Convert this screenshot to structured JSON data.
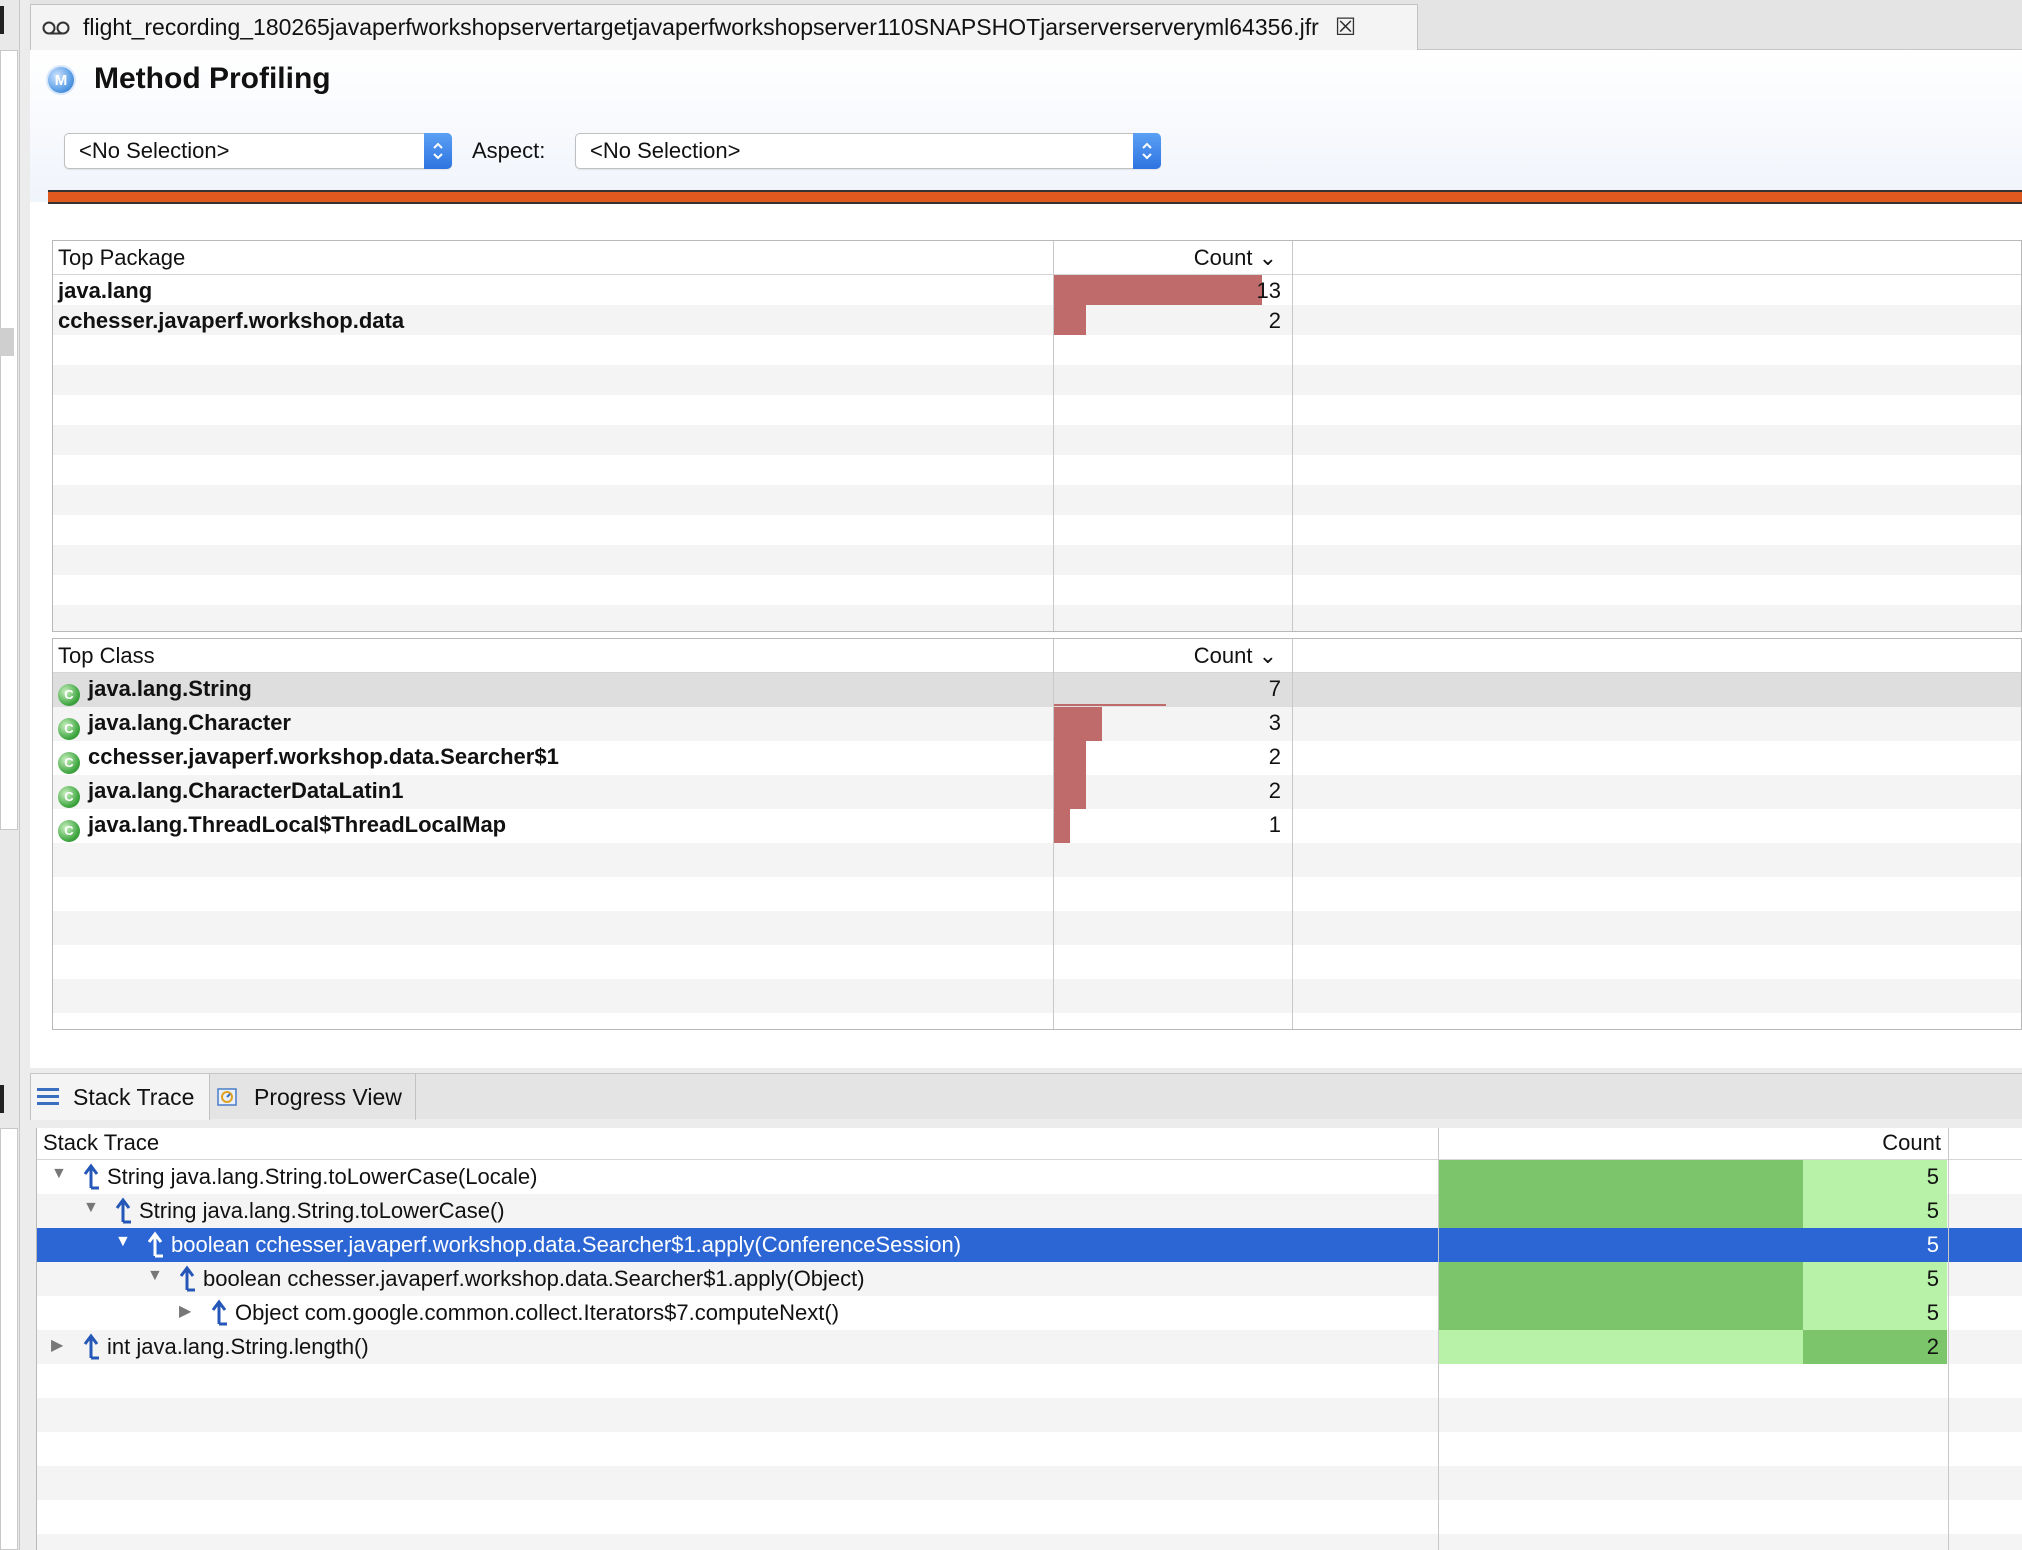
{
  "editor_tab": {
    "title": "flight_recording_180265javaperfworkshopservertargetjavaperfworkshopserver110SNAPSHOTjarserverserveryml64356.jfr",
    "icon": "recording-icon",
    "close_icon": "close-icon"
  },
  "header": {
    "icon_letter": "M",
    "title": "Method Profiling",
    "selection_combo": "<No Selection>",
    "aspect_label": "Aspect:",
    "aspect_combo": "<No Selection>",
    "accent_color": "#e05a20"
  },
  "top_package": {
    "header_name": "Top Package",
    "header_count": "Count",
    "rows": [
      {
        "name": "java.lang",
        "count": "13",
        "fraction": 1.0
      },
      {
        "name": "cchesser.javaperf.workshop.data",
        "count": "2",
        "fraction": 0.154
      }
    ]
  },
  "top_class": {
    "header_name": "Top Class",
    "header_count": "Count",
    "rows": [
      {
        "name": "java.lang.String",
        "count": "7",
        "fraction": 1.0
      },
      {
        "name": "java.lang.Character",
        "count": "3",
        "fraction": 0.429
      },
      {
        "name": "cchesser.javaperf.workshop.data.Searcher$1",
        "count": "2",
        "fraction": 0.286
      },
      {
        "name": "java.lang.CharacterDataLatin1",
        "count": "2",
        "fraction": 0.286
      },
      {
        "name": "java.lang.ThreadLocal$ThreadLocalMap",
        "count": "1",
        "fraction": 0.143
      }
    ]
  },
  "bottom_tabs": {
    "stack_trace": "Stack Trace",
    "progress_view": "Progress View"
  },
  "stack_trace": {
    "header_name": "Stack Trace",
    "header_count": "Count",
    "rows": [
      {
        "label": "String java.lang.String.toLowerCase(Locale)",
        "count": "5",
        "depth": 0,
        "toggle": "expanded"
      },
      {
        "label": "String java.lang.String.toLowerCase()",
        "count": "5",
        "depth": 1,
        "toggle": "expanded"
      },
      {
        "label": "boolean cchesser.javaperf.workshop.data.Searcher$1.apply(ConferenceSession)",
        "count": "5",
        "depth": 2,
        "toggle": "expanded",
        "selected": true
      },
      {
        "label": "boolean cchesser.javaperf.workshop.data.Searcher$1.apply(Object)",
        "count": "5",
        "depth": 3,
        "toggle": "expanded"
      },
      {
        "label": "Object com.google.common.collect.Iterators$7.computeNext()",
        "count": "5",
        "depth": 4,
        "toggle": "collapsed"
      },
      {
        "label": "int java.lang.String.length()",
        "count": "2",
        "depth": 0,
        "toggle": "collapsed"
      }
    ]
  }
}
